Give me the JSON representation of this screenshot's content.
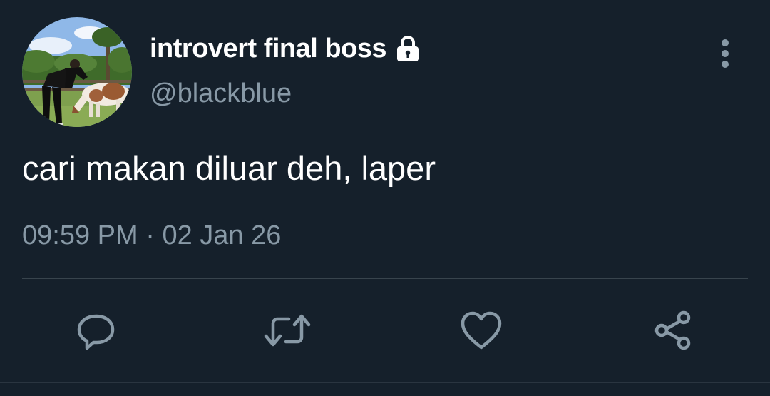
{
  "user": {
    "display_name": "introvert final boss",
    "handle": "@blackblue",
    "avatar_icon": "profile-photo-person-with-pony",
    "protected_icon": "lock-icon"
  },
  "tweet": {
    "text": "cari makan diluar deh, laper",
    "time": "09:59 PM",
    "separator": "·",
    "date": "02 Jan 26"
  },
  "actions": [
    {
      "icon": "reply-icon"
    },
    {
      "icon": "retweet-icon"
    },
    {
      "icon": "like-icon"
    },
    {
      "icon": "share-icon"
    }
  ],
  "menu": {
    "icon": "more-vertical-icon"
  },
  "colors": {
    "background": "#15202b",
    "primary_text": "#ffffff",
    "secondary_text": "#8899a6",
    "divider": "#38444d"
  }
}
